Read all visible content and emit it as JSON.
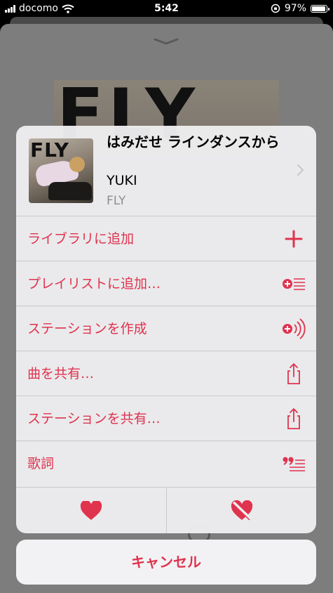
{
  "status_bar": {
    "carrier": "docomo",
    "time": "5:42",
    "battery_percent": "97%",
    "battery_level": 0.97
  },
  "background": {
    "album_art_text": "FLY"
  },
  "song": {
    "title": "はみだせ ラインダンスから",
    "artist": "YUKI",
    "album": "FLY",
    "album_art_text": "FLY"
  },
  "menu": [
    {
      "label": "ライブラリに追加",
      "icon": "plus-icon"
    },
    {
      "label": "プレイリストに追加…",
      "icon": "add-to-playlist-icon"
    },
    {
      "label": "ステーションを作成",
      "icon": "create-station-icon"
    },
    {
      "label": "曲を共有…",
      "icon": "share-icon"
    },
    {
      "label": "ステーションを共有…",
      "icon": "share-icon"
    },
    {
      "label": "歌詞",
      "icon": "lyrics-icon"
    }
  ],
  "actions": {
    "love": "heart-icon",
    "dislike": "dislike-heart-icon"
  },
  "cancel_label": "キャンセル",
  "colors": {
    "accent": "#e0334e"
  }
}
